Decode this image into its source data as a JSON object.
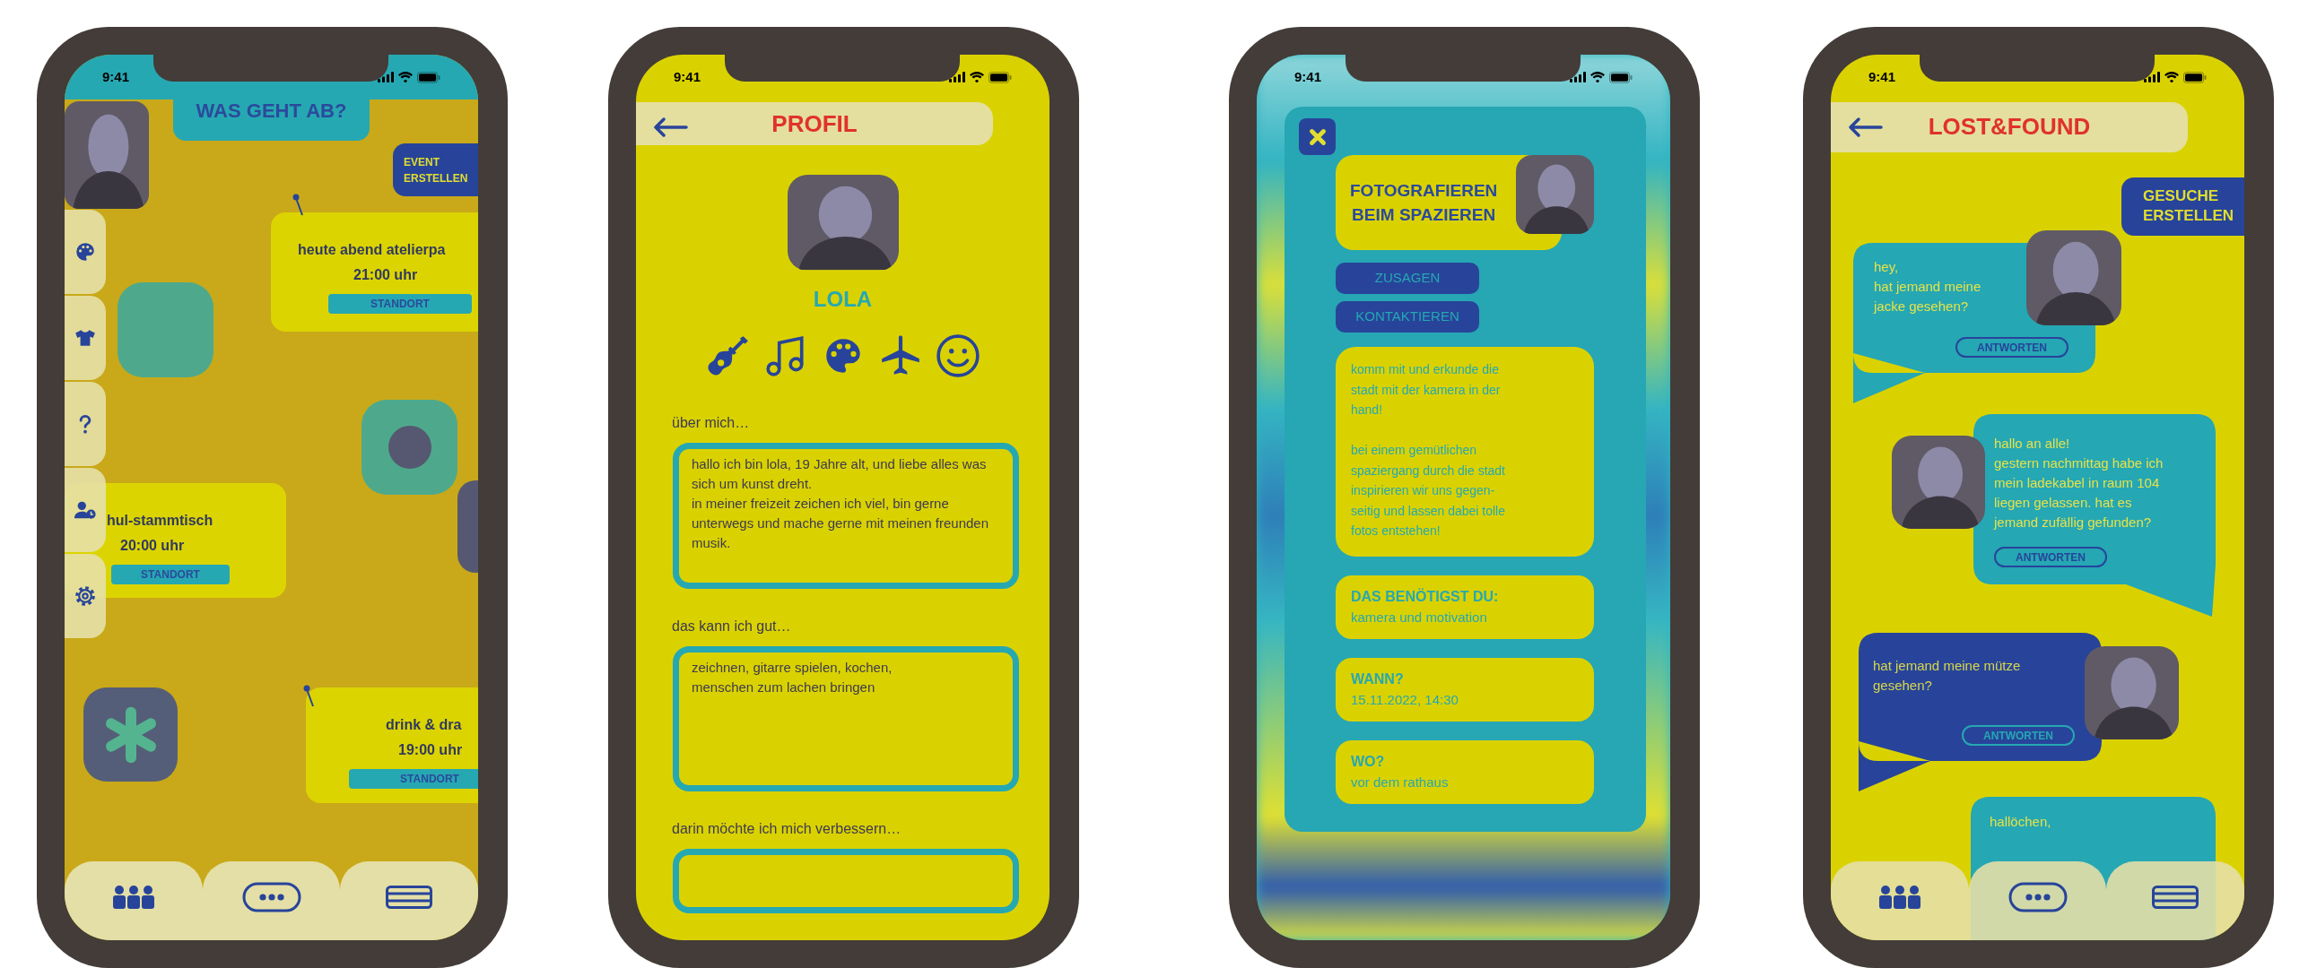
{
  "screens": [
    {
      "kind": "board",
      "status_time": "9:41",
      "title": "WAS GEHT AB?",
      "create_button": "EVENT\nERSTELLEN",
      "events": [
        {
          "title": "heute abend atelierpa",
          "time": "21:00 uhr",
          "button": "STANDORT"
        },
        {
          "title": "hul-stammtisch",
          "time": "20:00 uhr",
          "button": "STANDORT"
        },
        {
          "title": "drink & dra",
          "time": "19:00 uhr",
          "button": "STANDORT"
        }
      ]
    },
    {
      "kind": "profile",
      "status_time": "9:41",
      "title": "PROFIL",
      "name": "LOLA",
      "sections": [
        {
          "label": "über mich…",
          "text": "hallo ich bin lola, 19 Jahre alt, und liebe alles was sich um kunst dreht.\nin meiner freizeit zeichen ich viel, bin gerne unterwegs und mache gerne mit meinen freunden musik."
        },
        {
          "label": "das kann ich gut…",
          "text": "zeichnen, gitarre spielen, kochen,\nmenschen zum lachen bringen"
        },
        {
          "label": "darin möchte ich mich verbessern…"
        }
      ]
    },
    {
      "kind": "event_detail",
      "status_time": "9:41",
      "title": "FOTOGRAFIEREN\nBEIM SPAZIEREN",
      "buttons": [
        "ZUSAGEN",
        "KONTAKTIEREN"
      ],
      "description": "komm mit und erkunde die\nstadt mit der kamera in der\nhand!\n\nbei einem gemütlichen\nspaziergang durch die stadt\ninspirieren wir uns gegen-\nseitig und lassen dabei tolle\nfotos entstehen!",
      "details": [
        {
          "label": "DAS BENÖTIGST DU:",
          "value": "kamera und motivation"
        },
        {
          "label": "WANN?",
          "value": "15.11.2022, 14:30"
        },
        {
          "label": "WO?",
          "value": "vor dem rathaus"
        }
      ]
    },
    {
      "kind": "lost_found",
      "status_time": "9:41",
      "title": "LOST&FOUND",
      "create_button": "GESUCHE\nERSTELLEN",
      "posts": [
        {
          "color": "#25a7b4",
          "text": "hey,\nhat jemand meine\njacke gesehen?",
          "button": "ANTWORTEN"
        },
        {
          "color": "#25a7b4",
          "text": "hallo an alle!\ngestern nachmittag habe ich\nmein ladekabel in raum 104\nliegen gelassen. hat es\njemand zufällig gefunden?",
          "button": "ANTWORTEN"
        },
        {
          "color": "#27449a",
          "text": "hat jemand meine mütze\ngesehen?",
          "button": "ANTWORTEN"
        },
        {
          "color": "#25a7b4",
          "text": "hallöchen,"
        }
      ]
    }
  ]
}
